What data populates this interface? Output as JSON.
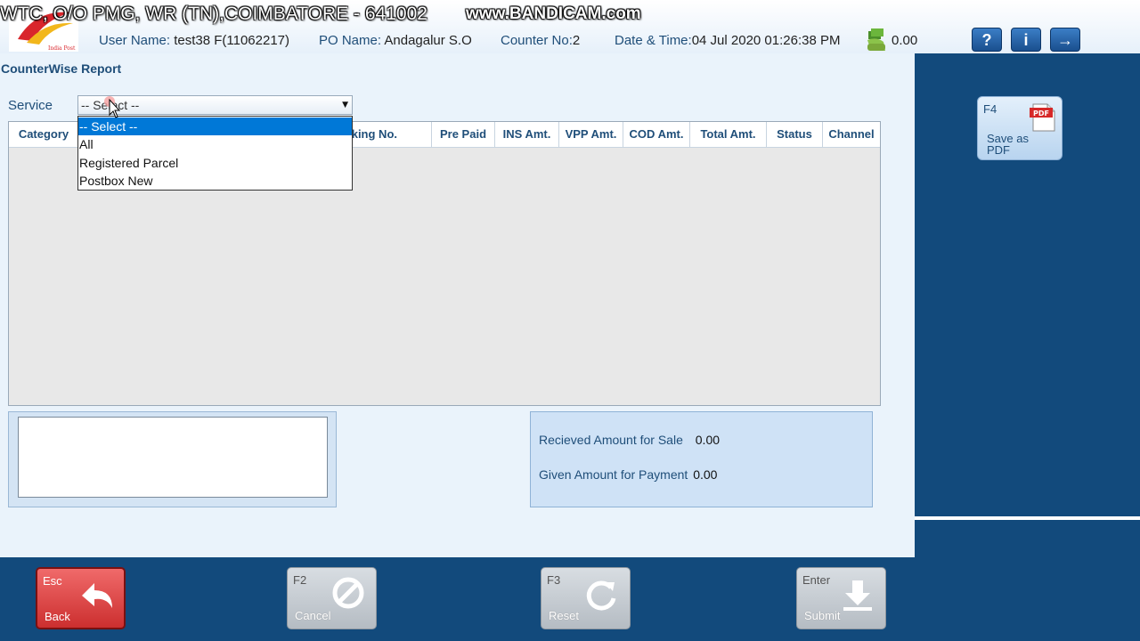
{
  "header": {
    "office_title": "WTC, O/O PMG, WR (TN),COIMBATORE - 641002",
    "watermark": "www.BANDICAM.com",
    "user_name_label": "User Name:",
    "user_name_value": "test38 F(11062217)",
    "po_name_label": "PO Name:",
    "po_name_value": "Andagalur S.O",
    "counter_label": "Counter No:",
    "counter_value": "2",
    "datetime_label": "Date & Time:",
    "datetime_value": "04 Jul 2020  01:26:38 PM",
    "balance": "0.00",
    "help_label": "?",
    "info_label": "i",
    "next_label": "→"
  },
  "report": {
    "title": "CounterWise Report",
    "service_label": "Service",
    "service_selected": "-- Select --"
  },
  "dropdown": {
    "options": [
      "-- Select --",
      "All",
      "Registered Parcel",
      "Postbox New"
    ],
    "highlighted_index": 0
  },
  "grid": {
    "columns": [
      "Category",
      "Booking No.",
      "Pre Paid",
      "INS Amt.",
      "VPP Amt.",
      "COD Amt.",
      "Total Amt.",
      "Status",
      "Channel"
    ],
    "visible_booking_header": "king No."
  },
  "amounts": {
    "received_label": "Recieved Amount for Sale",
    "received_value": "0.00",
    "given_label": "Given Amount for Payment",
    "given_value": "0.00"
  },
  "side": {
    "pdf_key": "F4",
    "pdf_label": "Save as PDF",
    "pdf_badge": "PDF"
  },
  "footer": {
    "back": {
      "key": "Esc",
      "label": "Back"
    },
    "cancel": {
      "key": "F2",
      "label": "Cancel"
    },
    "reset": {
      "key": "F3",
      "label": "Reset"
    },
    "submit": {
      "key": "Enter",
      "label": "Submit"
    }
  },
  "colors": {
    "navy": "#124a7c",
    "text_blue": "#1f4e79",
    "highlight": "#0078d7",
    "back_red": "#cc2f2f"
  }
}
